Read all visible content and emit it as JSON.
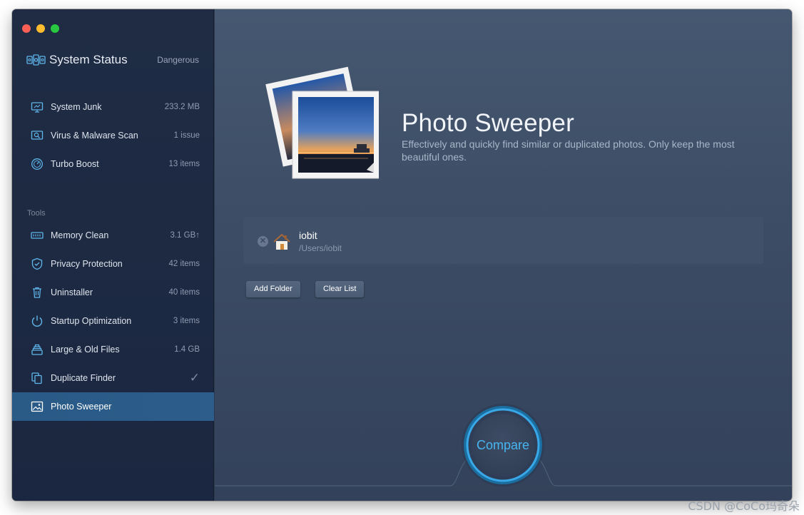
{
  "sidebar": {
    "status": {
      "title": "System Status",
      "value": "Dangerous"
    },
    "items_top": [
      {
        "label": "System Junk",
        "value": "233.2 MB",
        "icon": "monitor-icon"
      },
      {
        "label": "Virus & Malware Scan",
        "value": "1 issue",
        "icon": "magnifier-icon"
      },
      {
        "label": "Turbo Boost",
        "value": "13 items",
        "icon": "speedometer-icon"
      }
    ],
    "tools_label": "Tools",
    "items_tools": [
      {
        "label": "Memory Clean",
        "value": "3.1 GB↑",
        "icon": "memory-chip-icon"
      },
      {
        "label": "Privacy Protection",
        "value": "42 items",
        "icon": "shield-icon"
      },
      {
        "label": "Uninstaller",
        "value": "40 items",
        "icon": "trash-icon"
      },
      {
        "label": "Startup Optimization",
        "value": "3 items",
        "icon": "power-icon"
      },
      {
        "label": "Large & Old Files",
        "value": "1.4 GB",
        "icon": "file-stack-icon"
      },
      {
        "label": "Duplicate Finder",
        "value": "✓",
        "icon": "duplicate-files-icon"
      },
      {
        "label": "Photo Sweeper",
        "value": "",
        "icon": "photo-icon"
      }
    ]
  },
  "main": {
    "title": "Photo Sweeper",
    "description": "Effectively and quickly find similar or duplicated photos. Only keep the most beautiful ones.",
    "folder": {
      "name": "iobit",
      "path": "/Users/iobit"
    },
    "add_folder_label": "Add Folder",
    "clear_list_label": "Clear List",
    "compare_label": "Compare"
  },
  "watermark": "CSDN @CoCo玛奇朵",
  "colors": {
    "accent": "#47b5f0",
    "sidebar_active": "#2a5a86",
    "danger": "#fd5f57"
  }
}
